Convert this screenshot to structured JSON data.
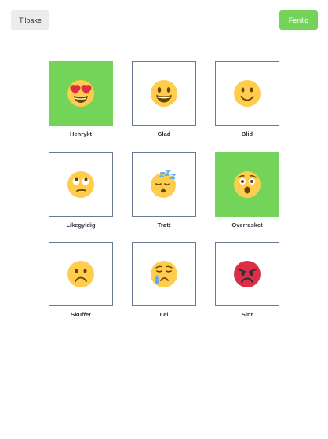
{
  "header": {
    "back_label": "Tilbake",
    "done_label": "Ferdig"
  },
  "moods": [
    {
      "label": "Henrykt",
      "icon": "heart-eyes-face-icon",
      "selected": true
    },
    {
      "label": "Glad",
      "icon": "grinning-face-icon",
      "selected": false
    },
    {
      "label": "Blid",
      "icon": "smiling-face-icon",
      "selected": false
    },
    {
      "label": "Likegyldig",
      "icon": "eye-roll-face-icon",
      "selected": false
    },
    {
      "label": "Trøtt",
      "icon": "sleeping-face-icon",
      "selected": false
    },
    {
      "label": "Overrasket",
      "icon": "surprised-face-icon",
      "selected": true
    },
    {
      "label": "Skuffet",
      "icon": "frowning-face-icon",
      "selected": false
    },
    {
      "label": "Lei",
      "icon": "crying-face-icon",
      "selected": false
    },
    {
      "label": "Sint",
      "icon": "angry-face-icon",
      "selected": false
    }
  ],
  "colors": {
    "accent": "#74d45a",
    "tile_border": "#6b7a90",
    "face": "#FFCC4D",
    "angry_face": "#DA2F47"
  }
}
